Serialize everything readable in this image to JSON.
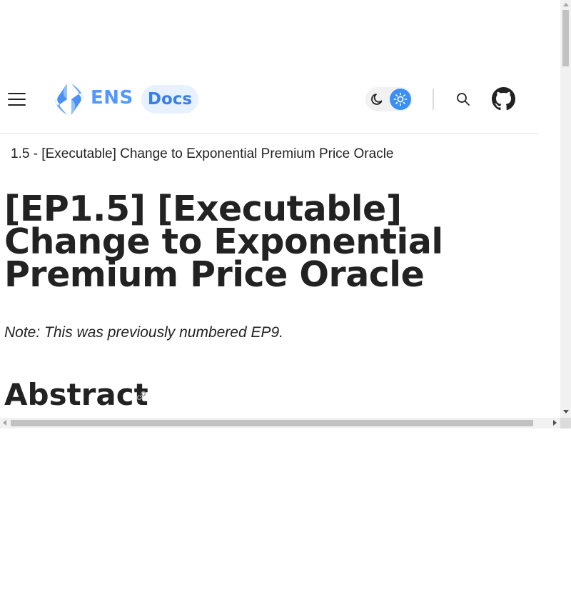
{
  "header": {
    "logo_text": "ENS",
    "docs_label": "Docs",
    "icons": {
      "menu": "hamburger-menu-icon",
      "logo": "ens-logo-icon",
      "moon": "moon-icon",
      "sun": "sun-icon",
      "search": "search-icon",
      "github": "github-icon"
    }
  },
  "breadcrumb": "1.5 - [Executable] Change to Exponential Premium Price Oracle",
  "main": {
    "title": "[EP1.5] [Executable] Change to Exponential Premium Price Oracle",
    "note": "Note: This was previously numbered EP9.",
    "sections": [
      {
        "heading": "Abstract",
        "anchor_icon": "link-icon"
      }
    ]
  },
  "colors": {
    "brand_blue": "#5298ff",
    "docs_pill_bg": "#e8f1ff",
    "toggle_active": "#3b8ff2",
    "text": "#222222"
  }
}
